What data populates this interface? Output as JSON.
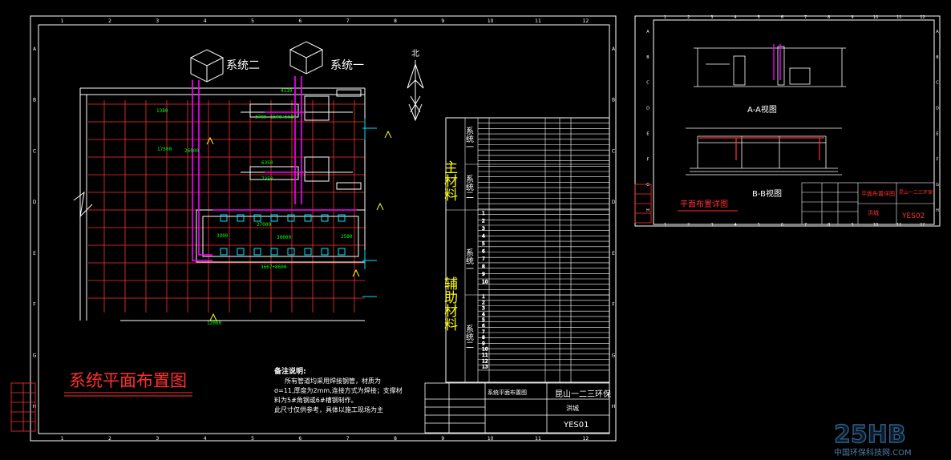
{
  "sheet1": {
    "title": "系统平面布置图",
    "north_label": "北",
    "system_labels": [
      "系统二",
      "系统一"
    ],
    "material_header": [
      "主材料",
      "辅助材料"
    ],
    "system_rows": [
      "系统一",
      "系统二",
      "系统一",
      "系统二"
    ],
    "row_numbers": [
      "1",
      "2",
      "3",
      "4",
      "5",
      "6",
      "7",
      "8",
      "9",
      "10",
      "11",
      "12",
      "13"
    ],
    "dimensions": [
      "27000",
      "30000",
      "3667+8600",
      "2580",
      "3900",
      "1380",
      "4130",
      "6350",
      "17500",
      "3700",
      "1590+5600",
      "7350",
      "26000",
      "12000"
    ],
    "notes": {
      "heading": "备注说明:",
      "lines": [
        "所有管道均采用焊接钢管，材质为",
        "σ=11,厚度为2mm,连接方式为焊接；支撑材",
        "料为5#角钢或6#槽钢制作。",
        "此尺寸仅供参考，具体以施工现场为主"
      ]
    },
    "title_block": {
      "drawing_name": "系统平面布置图",
      "company": "昆山一二三环保",
      "short": "洪城",
      "number": "YES01"
    },
    "grid_numbers": [
      "1",
      "2",
      "3",
      "4",
      "5",
      "6",
      "7",
      "8",
      "9",
      "10",
      "11",
      "12"
    ],
    "grid_letters": [
      "A",
      "B",
      "C",
      "D",
      "E",
      "F",
      "G",
      "H"
    ]
  },
  "sheet2": {
    "view_a": "A-A视图",
    "view_b": "B-B视图",
    "title": "平面布置详图",
    "title_block": {
      "drawing_name": "平面布置详图",
      "company": "昆山一二三环保",
      "short": "洪城",
      "number": "YES02"
    },
    "grid_numbers": [
      "1",
      "2",
      "3",
      "4",
      "5",
      "6",
      "7",
      "8",
      "9",
      "10",
      "11",
      "12"
    ],
    "grid_letters": [
      "A",
      "B",
      "C",
      "D",
      "E",
      "F",
      "G",
      "H"
    ]
  },
  "watermark": {
    "logo": "25HB",
    "caption": "中国环保科技网.COM"
  },
  "colors": {
    "background": "#000000",
    "frame": "#ffffff",
    "grid": "#ff3030",
    "pipe": "#ff00ff",
    "text": "#ffff00",
    "dimension": "#00ff00",
    "accent": "#00e5ff"
  }
}
